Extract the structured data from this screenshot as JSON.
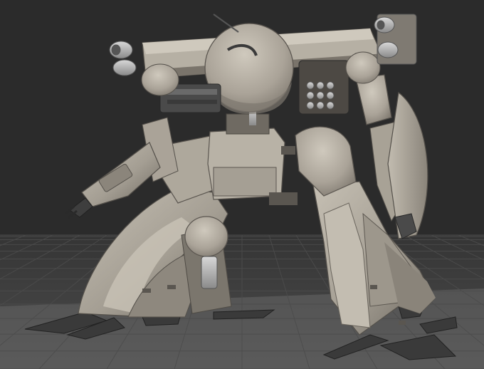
{
  "viewport": {
    "kind": "3d-viewport-render",
    "subject": "grey-untextured-mech-model",
    "grid": true
  },
  "colors": {
    "background": "#2b2b2b",
    "grid_line": "#4a4a4a",
    "floor_near": "#6a6a6a",
    "floor_far": "#3c3c3c",
    "mech_light": "#b9b3a8",
    "mech_mid": "#9a948a",
    "mech_dark": "#6f6a62",
    "mech_shadow": "#4d4944",
    "mech_metal": "#a7a7a7",
    "foot_dark": "#3a3a3a"
  }
}
